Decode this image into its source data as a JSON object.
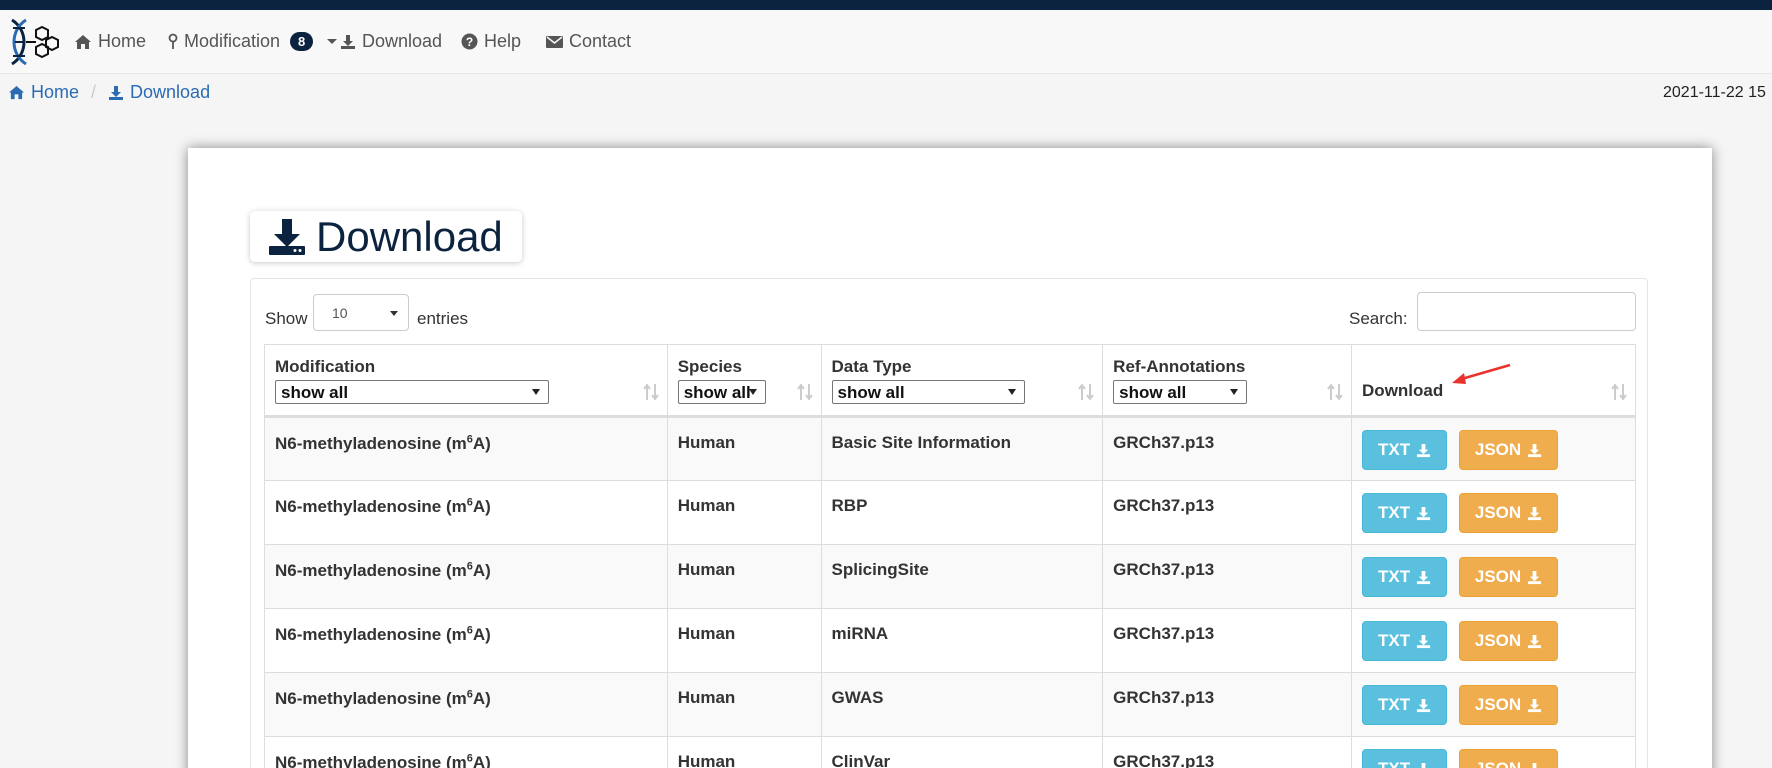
{
  "nav": {
    "items": [
      {
        "name": "home",
        "label": "Home"
      },
      {
        "name": "modification",
        "label": "Modification",
        "badge": "8"
      },
      {
        "name": "download",
        "label": "Download"
      },
      {
        "name": "help",
        "label": "Help"
      },
      {
        "name": "contact",
        "label": "Contact"
      }
    ]
  },
  "breadcrumb": {
    "home": "Home",
    "current": "Download"
  },
  "datetime": "2021-11-22 15",
  "page_title": "Download",
  "table_controls": {
    "show_label": "Show",
    "length_value": "10",
    "entries_label": "entries",
    "search_label": "Search:",
    "search_value": ""
  },
  "table": {
    "headers": {
      "modification": "Modification",
      "species": "Species",
      "data_type": "Data Type",
      "ref_annotations": "Ref-Annotations",
      "download": "Download"
    },
    "filter_value": "show all",
    "txt_label": "TXT",
    "json_label": "JSON",
    "modification_prefix": "N6-methyladenosine (m",
    "modification_sup": "6",
    "modification_suffix": "A)",
    "rows": [
      {
        "species": "Human",
        "data_type": "Basic Site Information",
        "ref": "GRCh37.p13"
      },
      {
        "species": "Human",
        "data_type": "RBP",
        "ref": "GRCh37.p13"
      },
      {
        "species": "Human",
        "data_type": "SplicingSite",
        "ref": "GRCh37.p13"
      },
      {
        "species": "Human",
        "data_type": "miRNA",
        "ref": "GRCh37.p13"
      },
      {
        "species": "Human",
        "data_type": "GWAS",
        "ref": "GRCh37.p13"
      },
      {
        "species": "Human",
        "data_type": "ClinVar",
        "ref": "GRCh37.p13"
      }
    ]
  },
  "colors": {
    "topbar": "#0c2340",
    "link": "#2a6bb2",
    "txt_button": "#5bc0de",
    "json_button": "#f0ad4e",
    "annotation_arrow": "#e8322b"
  }
}
